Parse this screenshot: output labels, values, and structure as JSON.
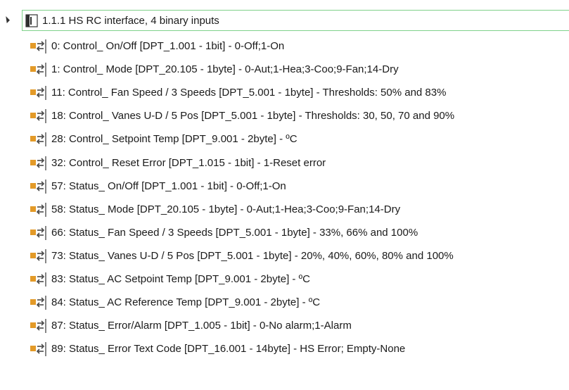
{
  "root": {
    "label": "1.1.1  HS RC interface, 4 binary inputs",
    "icon": "knx-device-icon",
    "expanded": true
  },
  "colors": {
    "object_square": "#e39a28",
    "arrows": "#4a4a4a",
    "tree_border": "#7fd18a"
  },
  "objects": [
    {
      "label": "0: Control_ On/Off [DPT_1.001 - 1bit] - 0-Off;1-On"
    },
    {
      "label": "1: Control_ Mode [DPT_20.105 - 1byte] - 0-Aut;1-Hea;3-Coo;9-Fan;14-Dry"
    },
    {
      "label": "11: Control_ Fan Speed / 3 Speeds [DPT_5.001 - 1byte]  - Thresholds: 50% and 83%"
    },
    {
      "label": "18: Control_ Vanes U-D / 5 Pos [DPT_5.001 - 1byte] - Thresholds: 30, 50, 70 and 90%"
    },
    {
      "label": "28: Control_ Setpoint Temp [DPT_9.001 - 2byte] -  ºC"
    },
    {
      "label": "32: Control_ Reset Error [DPT_1.015 - 1bit] - 1-Reset error"
    },
    {
      "label": "57: Status_ On/Off [DPT_1.001 - 1bit] - 0-Off;1-On"
    },
    {
      "label": "58: Status_ Mode [DPT_20.105 - 1byte] - 0-Aut;1-Hea;3-Coo;9-Fan;14-Dry"
    },
    {
      "label": "66: Status_ Fan Speed / 3 Speeds [DPT_5.001 - 1byte]  - 33%, 66% and 100%"
    },
    {
      "label": "73: Status_ Vanes U-D / 5 Pos [DPT_5.001 - 1byte] - 20%, 40%, 60%, 80% and 100%"
    },
    {
      "label": "83: Status_ AC Setpoint Temp [DPT_9.001 - 2byte] - ºC"
    },
    {
      "label": "84: Status_ AC Reference Temp [DPT_9.001 - 2byte] - ºC"
    },
    {
      "label": "87: Status_ Error/Alarm [DPT_1.005 - 1bit] - 0-No alarm;1-Alarm"
    },
    {
      "label": "89: Status_ Error Text Code [DPT_16.001 - 14byte] - HS Error; Empty-None"
    }
  ]
}
